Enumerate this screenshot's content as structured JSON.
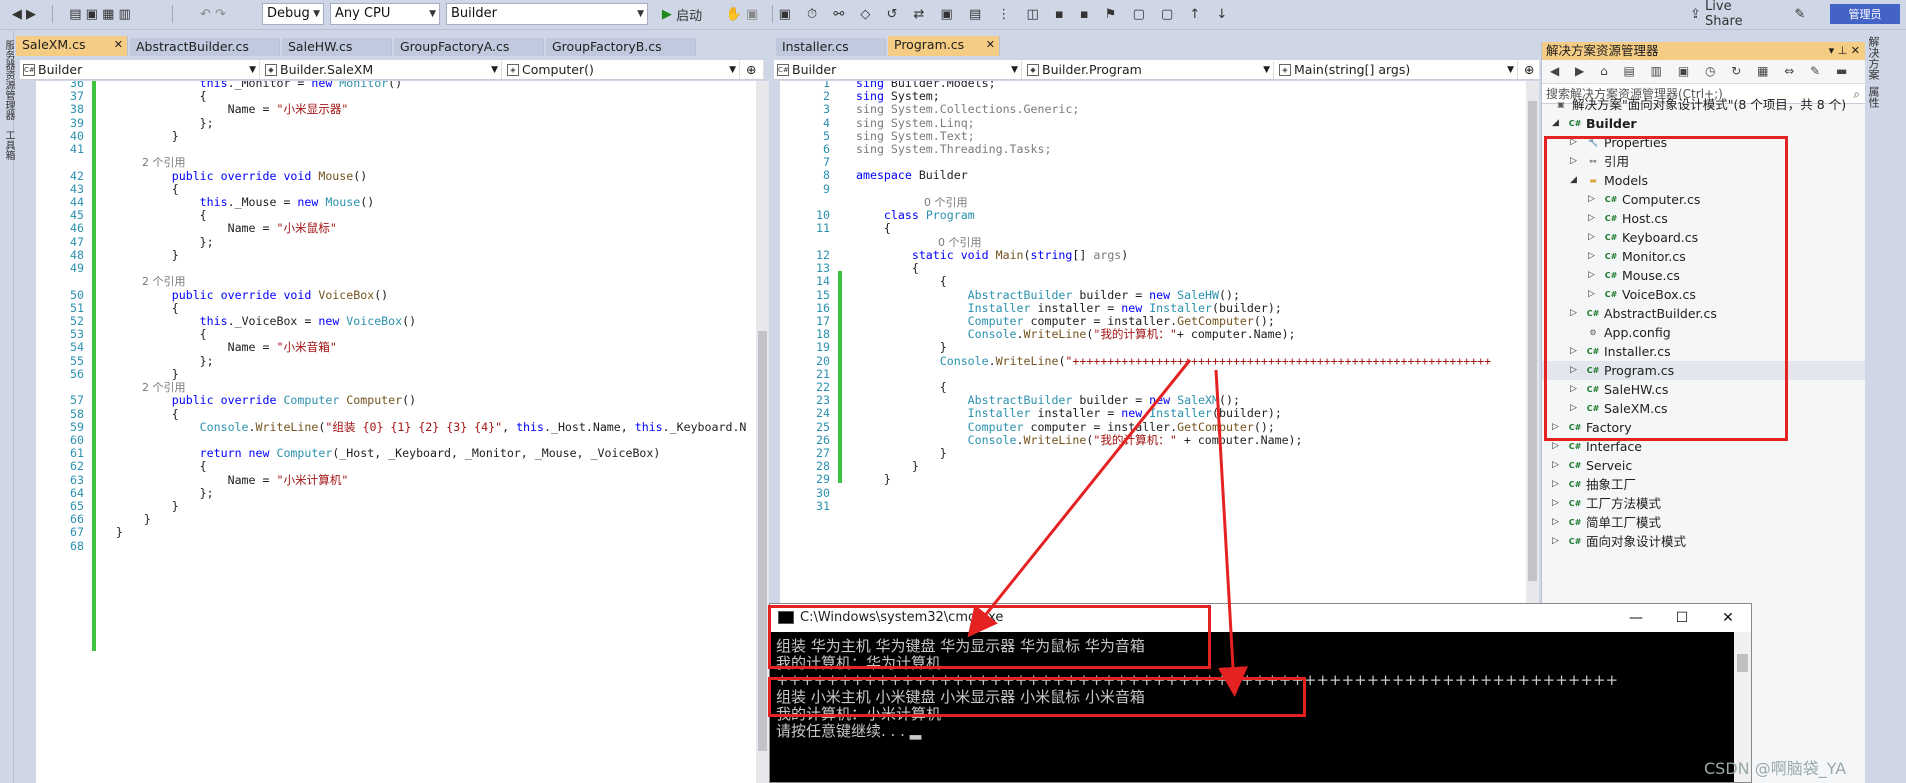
{
  "toolbar": {
    "config": "Debug",
    "platform": "Any CPU",
    "project": "Builder",
    "start": "启动",
    "live_share": "Live Share",
    "admin": "管理员"
  },
  "left_strip": [
    "服务器资源管理器",
    "工具箱"
  ],
  "right_strip": [
    "解决方案",
    "属性"
  ],
  "left_tabs": [
    {
      "label": "SaleXM.cs",
      "active": true
    },
    {
      "label": "AbstractBuilder.cs"
    },
    {
      "label": "SaleHW.cs"
    },
    {
      "label": "GroupFactoryA.cs"
    },
    {
      "label": "GroupFactoryB.cs"
    }
  ],
  "left_nav": {
    "project": "Builder",
    "class": "Builder.SaleXM",
    "member": "Computer()"
  },
  "left_code": [
    {
      "n": "36",
      "segs": [
        [
          "k",
          "                this"
        ],
        [
          "",
          "._Monitor = "
        ],
        [
          "k",
          "new "
        ],
        [
          "t",
          "Monitor"
        ],
        [
          "",
          "()"
        ]
      ]
    },
    {
      "n": "37",
      "segs": [
        [
          "",
          "                {"
        ]
      ]
    },
    {
      "n": "38",
      "segs": [
        [
          "",
          "                    Name = "
        ],
        [
          "s",
          "\"小米显示器\""
        ]
      ]
    },
    {
      "n": "39",
      "segs": [
        [
          "",
          "                };"
        ]
      ]
    },
    {
      "n": "40",
      "segs": [
        [
          "",
          "            }"
        ]
      ]
    },
    {
      "n": "41",
      "segs": [
        [
          "",
          "            "
        ]
      ]
    },
    {
      "n": "",
      "ref": "2 个引用"
    },
    {
      "n": "42",
      "segs": [
        [
          "k",
          "            public override void "
        ],
        [
          "m",
          "Mouse"
        ],
        [
          "",
          "()"
        ]
      ]
    },
    {
      "n": "43",
      "segs": [
        [
          "",
          "            {"
        ]
      ]
    },
    {
      "n": "44",
      "segs": [
        [
          "k",
          "                this"
        ],
        [
          "",
          "._Mouse = "
        ],
        [
          "k",
          "new "
        ],
        [
          "t",
          "Mouse"
        ],
        [
          "",
          "()"
        ]
      ]
    },
    {
      "n": "45",
      "segs": [
        [
          "",
          "                {"
        ]
      ]
    },
    {
      "n": "46",
      "segs": [
        [
          "",
          "                    Name = "
        ],
        [
          "s",
          "\"小米鼠标\""
        ]
      ]
    },
    {
      "n": "47",
      "segs": [
        [
          "",
          "                };"
        ]
      ]
    },
    {
      "n": "48",
      "segs": [
        [
          "",
          "            }"
        ]
      ]
    },
    {
      "n": "49",
      "segs": [
        [
          "",
          ""
        ]
      ]
    },
    {
      "n": "",
      "ref": "2 个引用"
    },
    {
      "n": "50",
      "segs": [
        [
          "k",
          "            public override void "
        ],
        [
          "m",
          "VoiceBox"
        ],
        [
          "",
          "()"
        ]
      ]
    },
    {
      "n": "51",
      "segs": [
        [
          "",
          "            {"
        ]
      ]
    },
    {
      "n": "52",
      "segs": [
        [
          "k",
          "                this"
        ],
        [
          "",
          "._VoiceBox = "
        ],
        [
          "k",
          "new "
        ],
        [
          "t",
          "VoiceBox"
        ],
        [
          "",
          "()"
        ]
      ]
    },
    {
      "n": "53",
      "segs": [
        [
          "",
          "                {"
        ]
      ]
    },
    {
      "n": "54",
      "segs": [
        [
          "",
          "                    Name = "
        ],
        [
          "s",
          "\"小米音箱\""
        ]
      ]
    },
    {
      "n": "55",
      "segs": [
        [
          "",
          "                };"
        ]
      ]
    },
    {
      "n": "56",
      "segs": [
        [
          "",
          "            }"
        ]
      ]
    },
    {
      "n": "",
      "ref": "2 个引用"
    },
    {
      "n": "57",
      "segs": [
        [
          "k",
          "            public override "
        ],
        [
          "t",
          "Computer "
        ],
        [
          "m",
          "Computer"
        ],
        [
          "",
          "()"
        ]
      ]
    },
    {
      "n": "58",
      "segs": [
        [
          "",
          "            {"
        ]
      ]
    },
    {
      "n": "59",
      "segs": [
        [
          "t",
          "                Console"
        ],
        [
          "",
          "."
        ],
        [
          "m",
          "WriteLine"
        ],
        [
          "",
          "("
        ],
        [
          "s",
          "\"组装 {0} {1} {2} {3} {4}\""
        ],
        [
          "",
          ", "
        ],
        [
          "k",
          "this"
        ],
        [
          "",
          "._Host.Name, "
        ],
        [
          "k",
          "this"
        ],
        [
          "",
          "._Keyboard.N"
        ]
      ]
    },
    {
      "n": "60",
      "segs": [
        [
          "",
          ""
        ]
      ]
    },
    {
      "n": "61",
      "segs": [
        [
          "k",
          "                return new "
        ],
        [
          "t",
          "Computer"
        ],
        [
          "",
          "(_Host, _Keyboard, _Monitor, _Mouse, _VoiceBox)"
        ]
      ]
    },
    {
      "n": "62",
      "segs": [
        [
          "",
          "                {"
        ]
      ]
    },
    {
      "n": "63",
      "segs": [
        [
          "",
          "                    Name = "
        ],
        [
          "s",
          "\"小米计算机\""
        ]
      ]
    },
    {
      "n": "64",
      "segs": [
        [
          "",
          "                };"
        ]
      ]
    },
    {
      "n": "65",
      "segs": [
        [
          "",
          "            }"
        ]
      ]
    },
    {
      "n": "66",
      "segs": [
        [
          "",
          "        }"
        ]
      ]
    },
    {
      "n": "67",
      "segs": [
        [
          "",
          "    }"
        ]
      ]
    },
    {
      "n": "68",
      "segs": [
        [
          "",
          ""
        ]
      ]
    }
  ],
  "mid_tabs": [
    {
      "label": "Installer.cs"
    },
    {
      "label": "Program.cs",
      "active": true
    }
  ],
  "mid_nav": {
    "project": "Builder",
    "class": "Builder.Program",
    "member": "Main(string[] args)"
  },
  "mid_code": [
    {
      "n": "1",
      "segs": [
        [
          "k",
          "sing "
        ],
        [
          "",
          "Builder.Models;"
        ]
      ]
    },
    {
      "n": "2",
      "segs": [
        [
          "k",
          "sing "
        ],
        [
          "",
          "System;"
        ]
      ]
    },
    {
      "n": "3",
      "segs": [
        [
          "g",
          "sing System.Collections.Generic;"
        ]
      ]
    },
    {
      "n": "4",
      "segs": [
        [
          "g",
          "sing System.Linq;"
        ]
      ]
    },
    {
      "n": "5",
      "segs": [
        [
          "g",
          "sing System.Text;"
        ]
      ]
    },
    {
      "n": "6",
      "segs": [
        [
          "g",
          "sing System.Threading.Tasks;"
        ]
      ]
    },
    {
      "n": "7",
      "segs": [
        [
          "",
          ""
        ]
      ]
    },
    {
      "n": "8",
      "segs": [
        [
          "k",
          "amespace "
        ],
        [
          "",
          "Builder"
        ]
      ]
    },
    {
      "n": "9",
      "segs": [
        [
          "",
          ""
        ]
      ]
    },
    {
      "n": "",
      "ref": "    0 个引用"
    },
    {
      "n": "10",
      "segs": [
        [
          "k",
          "    class "
        ],
        [
          "t",
          "Program"
        ]
      ]
    },
    {
      "n": "11",
      "segs": [
        [
          "",
          "    {"
        ]
      ]
    },
    {
      "n": "",
      "ref": "        0 个引用"
    },
    {
      "n": "12",
      "segs": [
        [
          "k",
          "        static void "
        ],
        [
          "m",
          "Main"
        ],
        [
          "",
          "("
        ],
        [
          "k",
          "string"
        ],
        [
          "",
          "[] "
        ],
        [
          "g",
          "args"
        ],
        [
          "",
          ")"
        ]
      ]
    },
    {
      "n": "13",
      "segs": [
        [
          "",
          "        {"
        ]
      ]
    },
    {
      "n": "14",
      "segs": [
        [
          "",
          "            {"
        ]
      ]
    },
    {
      "n": "15",
      "segs": [
        [
          "t",
          "                AbstractBuilder"
        ],
        [
          "",
          " builder = "
        ],
        [
          "k",
          "new "
        ],
        [
          "t",
          "SaleHW"
        ],
        [
          "",
          "();"
        ]
      ]
    },
    {
      "n": "16",
      "segs": [
        [
          "t",
          "                Installer"
        ],
        [
          "",
          " installer = "
        ],
        [
          "k",
          "new "
        ],
        [
          "t",
          "Installer"
        ],
        [
          "",
          "(builder);"
        ]
      ]
    },
    {
      "n": "17",
      "segs": [
        [
          "t",
          "                Computer"
        ],
        [
          "",
          " computer = installer."
        ],
        [
          "m",
          "GetComputer"
        ],
        [
          "",
          "();"
        ]
      ]
    },
    {
      "n": "18",
      "segs": [
        [
          "t",
          "                Console"
        ],
        [
          "",
          "."
        ],
        [
          "m",
          "WriteLine"
        ],
        [
          "",
          "("
        ],
        [
          "s",
          "\"我的计算机：\""
        ],
        [
          "",
          "+ computer.Name);"
        ]
      ]
    },
    {
      "n": "19",
      "segs": [
        [
          "",
          "            }"
        ]
      ]
    },
    {
      "n": "20",
      "segs": [
        [
          "t",
          "            Console"
        ],
        [
          "",
          "."
        ],
        [
          "m",
          "WriteLine"
        ],
        [
          "",
          "("
        ],
        [
          "s",
          "\"++++++++++++++++++++++++++++++++++++++++++++++++++++++++++++"
        ]
      ]
    },
    {
      "n": "21",
      "segs": [
        [
          "",
          ""
        ]
      ]
    },
    {
      "n": "22",
      "segs": [
        [
          "",
          "            {"
        ]
      ]
    },
    {
      "n": "23",
      "segs": [
        [
          "t",
          "                AbstractBuilder"
        ],
        [
          "",
          " builder = "
        ],
        [
          "k",
          "new "
        ],
        [
          "t",
          "SaleXM"
        ],
        [
          "",
          "();"
        ]
      ]
    },
    {
      "n": "24",
      "segs": [
        [
          "t",
          "                Installer"
        ],
        [
          "",
          " installer = "
        ],
        [
          "k",
          "new "
        ],
        [
          "t",
          "Installer"
        ],
        [
          "",
          "(builder);"
        ]
      ]
    },
    {
      "n": "25",
      "segs": [
        [
          "t",
          "                Computer"
        ],
        [
          "",
          " computer = installer."
        ],
        [
          "m",
          "GetComputer"
        ],
        [
          "",
          "();"
        ]
      ]
    },
    {
      "n": "26",
      "segs": [
        [
          "t",
          "                Console"
        ],
        [
          "",
          "."
        ],
        [
          "m",
          "WriteLine"
        ],
        [
          "",
          "("
        ],
        [
          "s",
          "\"我的计算机：\""
        ],
        [
          "",
          " + computer.Name);"
        ]
      ]
    },
    {
      "n": "27",
      "segs": [
        [
          "",
          "            }"
        ]
      ]
    },
    {
      "n": "28",
      "segs": [
        [
          "",
          "        }"
        ]
      ]
    },
    {
      "n": "29",
      "segs": [
        [
          "",
          "    }"
        ]
      ]
    },
    {
      "n": "30",
      "segs": [
        [
          "",
          ""
        ]
      ]
    },
    {
      "n": "31",
      "segs": [
        [
          "",
          ""
        ]
      ]
    }
  ],
  "solution": {
    "header": "解决方案资源管理器",
    "search_placeholder": "搜索解决方案资源管理器(Ctrl+;)",
    "root": "解决方案\"面向对象设计模式\"(8 个项目，共 8 个)",
    "items": [
      {
        "label": "Builder",
        "lvl": 1,
        "exp": "open",
        "icon": "C#",
        "bold": true
      },
      {
        "label": "Properties",
        "lvl": 2,
        "exp": "closed",
        "icon": "wrench"
      },
      {
        "label": "引用",
        "lvl": 2,
        "exp": "closed",
        "icon": "ref"
      },
      {
        "label": "Models",
        "lvl": 2,
        "exp": "open",
        "icon": "folder"
      },
      {
        "label": "Computer.cs",
        "lvl": 3,
        "exp": "closed",
        "icon": "C#"
      },
      {
        "label": "Host.cs",
        "lvl": 3,
        "exp": "closed",
        "icon": "C#"
      },
      {
        "label": "Keyboard.cs",
        "lvl": 3,
        "exp": "closed",
        "icon": "C#"
      },
      {
        "label": "Monitor.cs",
        "lvl": 3,
        "exp": "closed",
        "icon": "C#"
      },
      {
        "label": "Mouse.cs",
        "lvl": 3,
        "exp": "closed",
        "icon": "C#"
      },
      {
        "label": "VoiceBox.cs",
        "lvl": 3,
        "exp": "closed",
        "icon": "C#"
      },
      {
        "label": "AbstractBuilder.cs",
        "lvl": 2,
        "exp": "closed",
        "icon": "C#"
      },
      {
        "label": "App.config",
        "lvl": 2,
        "exp": "",
        "icon": "cfg"
      },
      {
        "label": "Installer.cs",
        "lvl": 2,
        "exp": "closed",
        "icon": "C#"
      },
      {
        "label": "Program.cs",
        "lvl": 2,
        "exp": "closed",
        "icon": "C#",
        "selected": true
      },
      {
        "label": "SaleHW.cs",
        "lvl": 2,
        "exp": "closed",
        "icon": "C#"
      },
      {
        "label": "SaleXM.cs",
        "lvl": 2,
        "exp": "closed",
        "icon": "C#"
      },
      {
        "label": "Factory",
        "lvl": 1,
        "exp": "closed",
        "icon": "C#"
      },
      {
        "label": "Interface",
        "lvl": 1,
        "exp": "closed",
        "icon": "C#"
      },
      {
        "label": "Serveic",
        "lvl": 1,
        "exp": "closed",
        "icon": "C#"
      },
      {
        "label": "抽象工厂",
        "lvl": 1,
        "exp": "closed",
        "icon": "C#"
      },
      {
        "label": "工厂方法模式",
        "lvl": 1,
        "exp": "closed",
        "icon": "C#"
      },
      {
        "label": "简单工厂模式",
        "lvl": 1,
        "exp": "closed",
        "icon": "C#"
      },
      {
        "label": "面向对象设计模式",
        "lvl": 1,
        "exp": "closed",
        "icon": "C#"
      }
    ]
  },
  "cmd": {
    "title": "C:\\Windows\\system32\\cmd.exe",
    "lines": [
      "组装 华为主机 华为键盘 华为显示器 华为鼠标 华为音箱",
      "我的计算机：华为计算机",
      "+++++++++++++++++++++++++++++++++++++++++++++++++++++++++++++++++++",
      "组装 小米主机 小米键盘 小米显示器 小米鼠标 小米音箱",
      "我的计算机：小米计算机",
      "请按任意键继续. . . ▂"
    ]
  },
  "watermark": "CSDN @啊脑袋_YA",
  "colors": {
    "tab_active": "#f5cc84",
    "chrome": "#cfd6e5",
    "annotation_red": "#e52222",
    "change_green": "#3dc23d"
  }
}
